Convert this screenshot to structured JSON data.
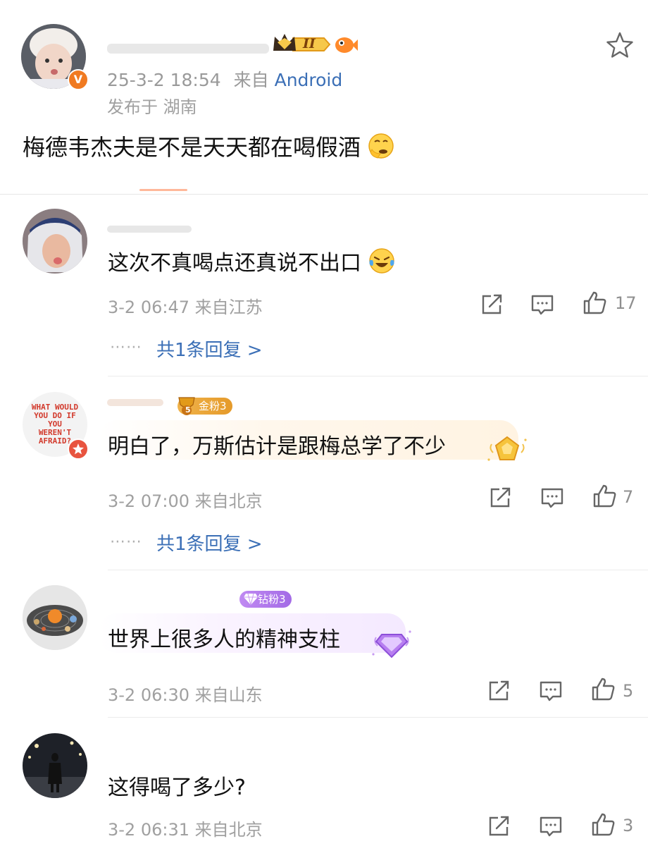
{
  "post": {
    "time": "25-3-2 18:54",
    "source_prefix": "来自",
    "source_device": "Android",
    "location": "发布于 湖南",
    "text": "梅德韦杰夫是不是天天都在喝假酒",
    "level_badge": "II",
    "verified_badge": "V"
  },
  "comments": [
    {
      "text": "这次不真喝点还真说不出口",
      "meta": "3-2 06:47 来自江苏",
      "likes": "17",
      "replies": "共1条回复 >",
      "emoji": "laughing-crying-emoji"
    },
    {
      "text": "明白了，万斯估计是跟梅总学了不少",
      "meta": "3-2 07:00 来自北京",
      "likes": "7",
      "replies": "共1条回复 >",
      "fan_badge": "金粉3",
      "fan_level": "5",
      "avatar_text": "WHAT WOULD YOU DO IF YOU WEREN'T AFRAID?"
    },
    {
      "text": "世界上很多人的精神支柱",
      "meta": "3-2 06:30 来自山东",
      "likes": "5",
      "fan_badge": "钻粉3"
    },
    {
      "text": "这得喝了多少?",
      "meta": "3-2 06:31 来自北京",
      "likes": "3"
    }
  ],
  "dots": "⋯⋯",
  "colors": {
    "link": "#3b6fb6",
    "gold_badge": "#e8a83a",
    "diamond_badge": "#b07de8",
    "verified": "#f07a21"
  }
}
